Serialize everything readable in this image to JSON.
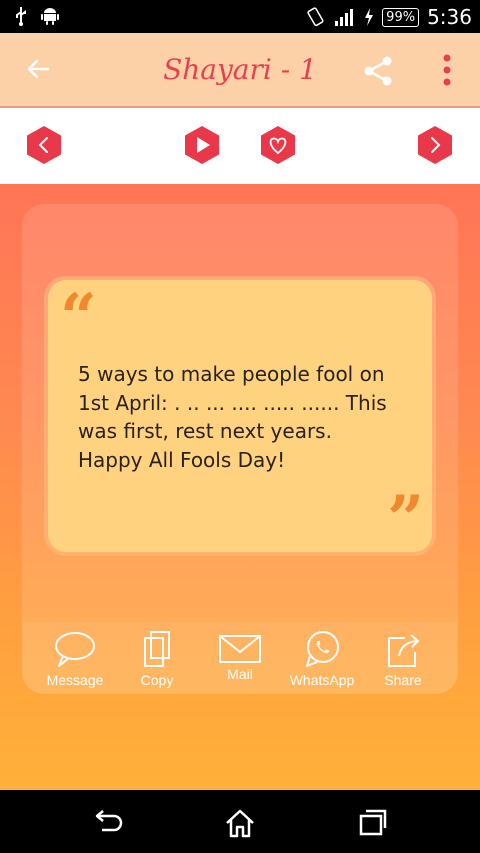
{
  "status_bar": {
    "battery": "99%",
    "time": "5:36"
  },
  "app_bar": {
    "title": "Shayari - 1"
  },
  "card": {
    "text": "5 ways to make people fool on\n1st April: . .. ... .... ..... ...... This\nwas first, rest next years.\nHappy All Fools Day!",
    "open_quote": "“",
    "close_quote": "”"
  },
  "actions": [
    {
      "label": "Message",
      "icon": "message-icon"
    },
    {
      "label": "Copy",
      "icon": "copy-icon"
    },
    {
      "label": "Mail",
      "icon": "mail-icon"
    },
    {
      "label": "WhatsApp",
      "icon": "whatsapp-icon"
    },
    {
      "label": "Share",
      "icon": "share-out-icon"
    }
  ],
  "colors": {
    "app_bar": "#fdd1a8",
    "title": "#e74050",
    "hex_button": "#e8384a",
    "card": "#ffd27f",
    "quote_mark": "#f0882d"
  }
}
